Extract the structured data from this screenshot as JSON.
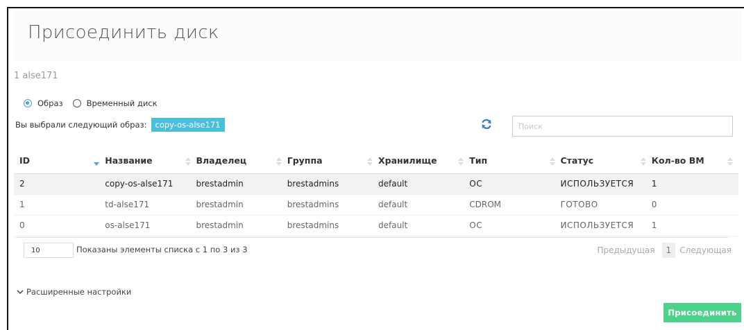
{
  "dialog": {
    "title": "Присоединить диск",
    "subtitle": "1 alse171"
  },
  "source": {
    "options": [
      {
        "label": "Образ",
        "checked": true
      },
      {
        "label": "Временный диск",
        "checked": false
      }
    ],
    "selected_prefix": "Вы выбрали следующий образ:",
    "selected_image": "copy-os-alse171"
  },
  "search": {
    "placeholder": "Поиск"
  },
  "table": {
    "columns": [
      "ID",
      "Название",
      "Владелец",
      "Группа",
      "Хранилище",
      "Тип",
      "Статус",
      "Кол-во ВМ"
    ],
    "rows": [
      [
        "2",
        "copy-os-alse171",
        "brestadmin",
        "brestadmins",
        "default",
        "ОС",
        "ИСПОЛЬЗУЕТСЯ",
        "1"
      ],
      [
        "1",
        "td-alse171",
        "brestadmin",
        "brestadmins",
        "default",
        "CDROM",
        "ГОТОВО",
        "0"
      ],
      [
        "0",
        "os-alse171",
        "brestadmin",
        "brestadmins",
        "default",
        "ОС",
        "ИСПОЛЬЗУЕТСЯ",
        "1"
      ]
    ]
  },
  "pagination": {
    "page_size": "10",
    "info": "Показаны элементы списка с 1 по 3 из 3",
    "prev": "Предыдущая",
    "current": "1",
    "next": "Следующая"
  },
  "advanced_label": "Расширенные настройки",
  "attach_button": "Присоединить",
  "colors": {
    "accent": "#4aa3df",
    "badge": "#4bbfd9",
    "primary_button": "#4cd28a"
  }
}
